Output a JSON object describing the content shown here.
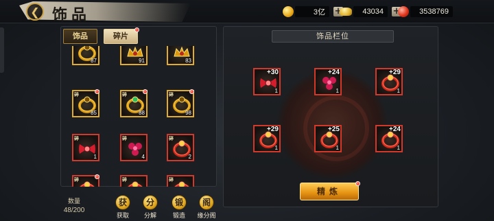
{
  "header": {
    "back_icon": "back-arrow-icon",
    "title": "饰品"
  },
  "resources": [
    {
      "icon": "gold-coin-icon",
      "value": "3亿"
    },
    {
      "icon": "gold-ingot-icon",
      "value": "43034"
    },
    {
      "icon": "red-gem-icon",
      "value": "3538769"
    }
  ],
  "tabs": [
    {
      "label": "饰品",
      "active": true
    },
    {
      "label": "碎片",
      "active": false,
      "badge": true
    }
  ],
  "inventory": [
    {
      "count": "87",
      "tier": "gold",
      "tag": "",
      "badge": false,
      "kind": "gold-ring"
    },
    {
      "count": "91",
      "tier": "gold",
      "tag": "",
      "badge": false,
      "kind": "gold-crown"
    },
    {
      "count": "83",
      "tier": "gold",
      "tag": "",
      "badge": false,
      "kind": "gold-crown"
    },
    {
      "count": "85",
      "tier": "gold",
      "tag": "碎",
      "badge": true,
      "kind": "gold-ring"
    },
    {
      "count": "88",
      "tier": "gold",
      "tag": "碎",
      "badge": true,
      "kind": "jade-ring"
    },
    {
      "count": "98",
      "tier": "gold",
      "tag": "碎",
      "badge": true,
      "kind": "gold-ring"
    },
    {
      "count": "1",
      "tier": "red",
      "tag": "碎",
      "badge": false,
      "kind": "red-bow"
    },
    {
      "count": "4",
      "tier": "red",
      "tag": "碎",
      "badge": false,
      "kind": "red-flower"
    },
    {
      "count": "2",
      "tier": "red",
      "tag": "碎",
      "badge": false,
      "kind": "red-ring"
    },
    {
      "count": "4",
      "tier": "red",
      "tag": "碎",
      "badge": true,
      "kind": "red-ring"
    },
    {
      "count": "1",
      "tier": "red",
      "tag": "碎",
      "badge": false,
      "kind": "red-ring"
    },
    {
      "count": "4",
      "tier": "red",
      "tag": "碎",
      "badge": false,
      "kind": "red-ring"
    }
  ],
  "quantity": {
    "label": "数量",
    "value": "48/200"
  },
  "actions": [
    {
      "label": "获取",
      "icon": "acquire-icon",
      "glyph": "获"
    },
    {
      "label": "分解",
      "icon": "decompose-icon",
      "glyph": "分"
    },
    {
      "label": "锻造",
      "icon": "forge-icon",
      "glyph": "锻"
    },
    {
      "label": "缘分阁",
      "icon": "pavilion-icon",
      "glyph": "阁"
    }
  ],
  "slots_title": "饰品栏位",
  "slots": [
    {
      "level": "+30",
      "num": "1",
      "kind": "red-bow"
    },
    {
      "level": "+24",
      "num": "1",
      "kind": "red-flower"
    },
    {
      "level": "+29",
      "num": "1",
      "kind": "red-ring"
    },
    {
      "level": "+29",
      "num": "1",
      "kind": "red-ring"
    },
    {
      "level": "+25",
      "num": "1",
      "kind": "red-ring"
    },
    {
      "level": "+24",
      "num": "1",
      "kind": "red-ring"
    }
  ],
  "refine_button": "精炼",
  "colors": {
    "gold_border": "#e2ad2c",
    "red_border": "#d13a2a",
    "accent_button": "#e59212"
  }
}
